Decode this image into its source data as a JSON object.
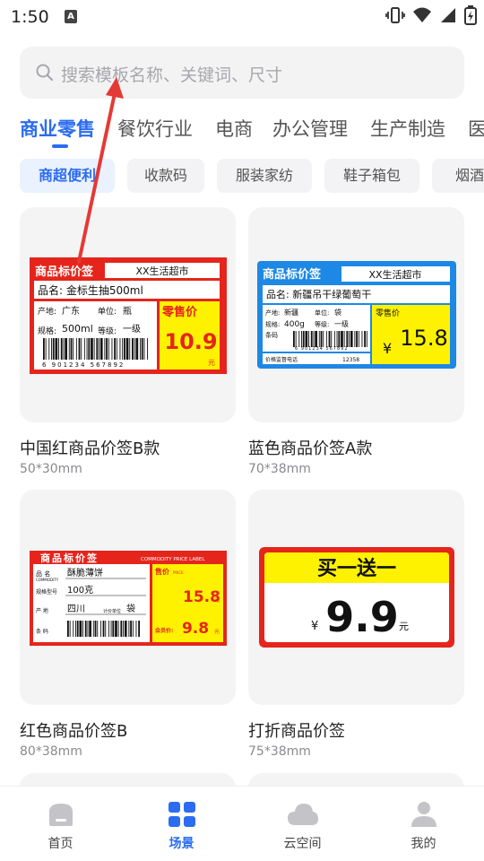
{
  "status_bar": {
    "time": "1:50",
    "app_badge": "A"
  },
  "search": {
    "placeholder": "搜索模板名称、关键词、尺寸"
  },
  "tabs": [
    {
      "label": "商业零售",
      "active": true
    },
    {
      "label": "餐饮行业",
      "active": false
    },
    {
      "label": "电商",
      "active": false
    },
    {
      "label": "办公管理",
      "active": false
    },
    {
      "label": "生产制造",
      "active": false
    },
    {
      "label": "医",
      "active": false
    }
  ],
  "chips": [
    {
      "label": "商超便利",
      "active": true
    },
    {
      "label": "收款码",
      "active": false
    },
    {
      "label": "服装家纺",
      "active": false
    },
    {
      "label": "鞋子箱包",
      "active": false
    },
    {
      "label": "烟酒茶",
      "active": false
    }
  ],
  "templates": [
    {
      "title": "中国红商品价签B款",
      "size": "50*30mm",
      "label": {
        "header": "商品标价签",
        "store": "XX生活超市",
        "name_row": "品名: 金标生抽500ml",
        "origin_label": "产地:",
        "origin": "广东",
        "unit_label": "单位:",
        "unit": "瓶",
        "spec_label": "规格:",
        "spec": "500ml",
        "grade_label": "等级:",
        "grade": "一级",
        "barcode_digits": "6 901234 567892",
        "price_label": "零售价",
        "price": "10.9",
        "currency": "元"
      }
    },
    {
      "title": "蓝色商品价签A款",
      "size": "70*38mm",
      "label": {
        "header": "商品标价签",
        "store": "XX生活超市",
        "name_row": "品名: 新疆吊干绿葡萄干",
        "origin_label": "产地:",
        "origin": "新疆",
        "unit_label": "单位:",
        "unit": "袋",
        "spec_label": "规格:",
        "spec": "400g",
        "grade_label": "等级:",
        "grade": "一级",
        "extra_label": "条码",
        "barcode_digits": "6 901234 567892",
        "footer_left": "价格监督电话",
        "footer_right": "12358",
        "price_label": "零售价",
        "currency": "¥",
        "price": "15.8"
      }
    },
    {
      "title": "红色商品价签B",
      "size": "80*38mm",
      "label": {
        "header": "商品标价签",
        "header_en": "COMMODITY PRICE LABEL",
        "name_label": "品 名",
        "name_en": "COMMODITY",
        "name": "酥脆薄饼",
        "spec_label": "规格型号",
        "spec": "100克",
        "origin_label": "产 地",
        "origin": "四川",
        "unit_label": "计价单位",
        "unit": "袋",
        "barcode_label": "条 码",
        "price_label": "售价",
        "price_label_en": "PRICE",
        "price": "15.8",
        "currency": "元",
        "member_label": "会员价:",
        "member_price": "9.8"
      }
    },
    {
      "title": "打折商品价签",
      "size": "75*38mm",
      "label": {
        "banner": "买一送一",
        "currency": "¥",
        "price": "9.9",
        "unit": "元"
      }
    }
  ],
  "bottom_nav": [
    {
      "label": "首页",
      "icon": "home-icon",
      "active": false
    },
    {
      "label": "场景",
      "icon": "grid-icon",
      "active": true
    },
    {
      "label": "云空间",
      "icon": "cloud-icon",
      "active": false
    },
    {
      "label": "我的",
      "icon": "person-icon",
      "active": false
    }
  ],
  "colors": {
    "accent": "#2b6cf0",
    "red": "#e5251c",
    "blue": "#1e88e5",
    "yellow": "#fff200",
    "annotation_arrow": "#e53935"
  }
}
